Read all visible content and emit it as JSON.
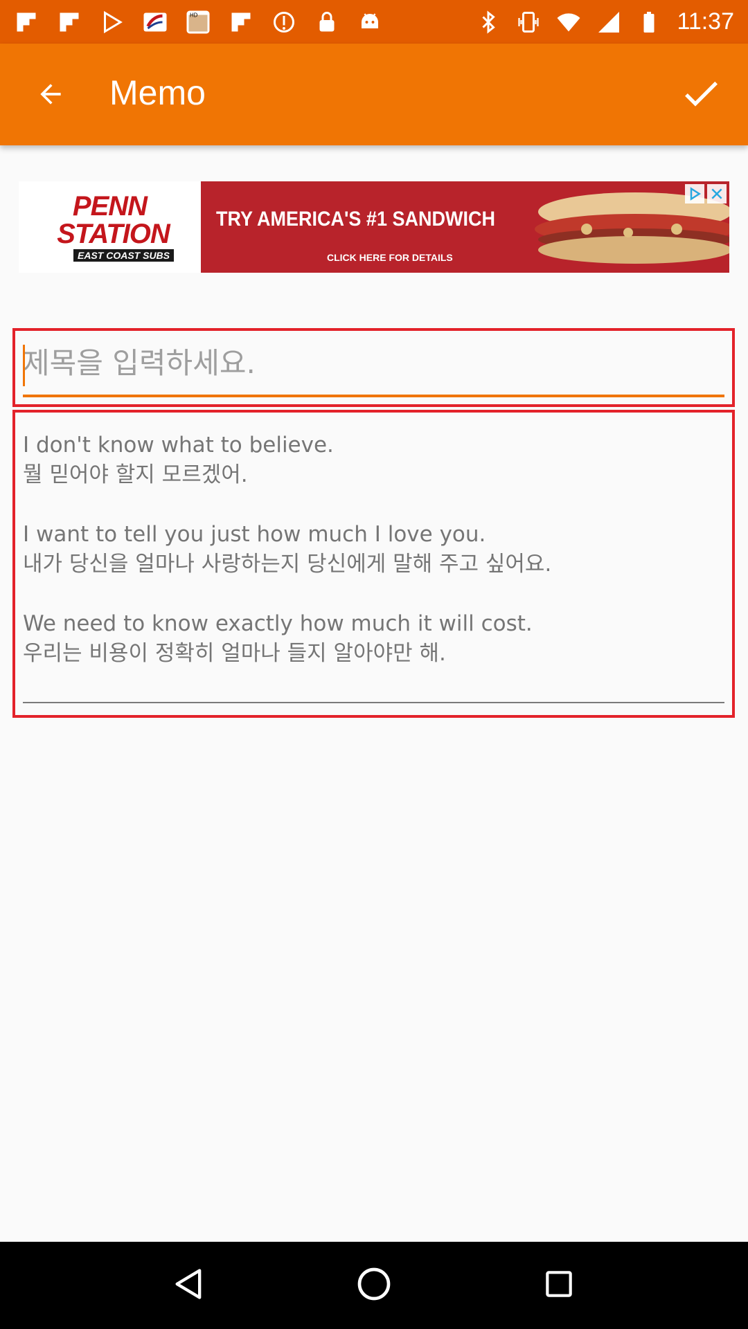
{
  "status_bar": {
    "time": "11:37",
    "left_icons": [
      "flipboard-icon",
      "flipboard-icon",
      "play-store-icon",
      "malaysia-airlines-icon",
      "hd-photo-icon",
      "flipboard-icon",
      "info-circle-icon",
      "lock-icon",
      "android-icon"
    ],
    "right_icons": [
      "bluetooth-icon",
      "vibrate-icon",
      "wifi-icon",
      "signal-icon",
      "battery-icon"
    ]
  },
  "app_bar": {
    "title": "Memo",
    "back_icon": "arrow-back-icon",
    "confirm_icon": "check-icon",
    "color": "#f07504"
  },
  "ad": {
    "logo_line1": "PENN",
    "logo_line2": "STATION",
    "logo_sub": "EAST COAST SUBS",
    "headline": "TRY AMERICA'S #1 SANDWICH",
    "cta": "CLICK HERE FOR DETAILS"
  },
  "title_field": {
    "placeholder": "제목을 입력하세요.",
    "value": ""
  },
  "body_field": {
    "text": "I don't know what to believe.\n뭘 믿어야 할지 모르겠어.\n\nI want to tell you just how much I love you.\n내가 당신을 얼마나 사랑하는지 당신에게 말해 주고 싶어요.\n\nWe need to know exactly how much it will cost.\n우리는 비용이 정확히 얼마나 들지 알아야만 해."
  },
  "nav_bar": {
    "back": "nav-back-icon",
    "home": "nav-home-icon",
    "recents": "nav-recents-icon"
  }
}
